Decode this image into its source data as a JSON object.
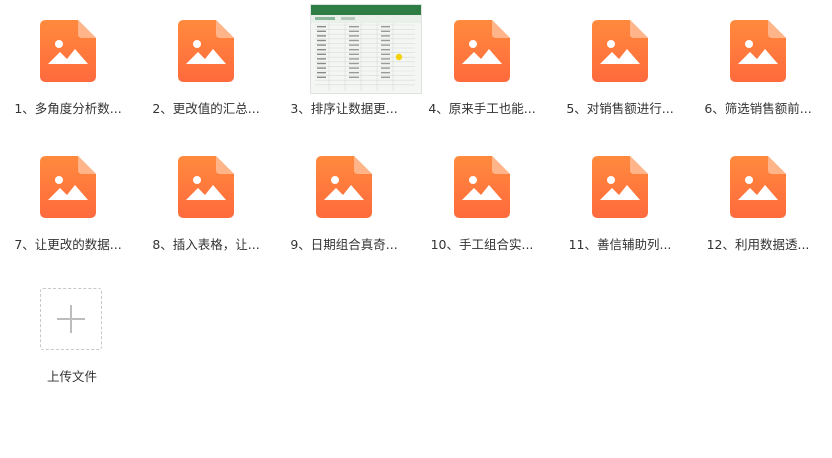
{
  "files": [
    {
      "label": "1、多角度分析数...",
      "type": "image-icon"
    },
    {
      "label": "2、更改值的汇总...",
      "type": "image-icon"
    },
    {
      "label": "3、排序让数据更...",
      "type": "spreadsheet-thumbnail"
    },
    {
      "label": "4、原来手工也能...",
      "type": "image-icon"
    },
    {
      "label": "5、对销售额进行...",
      "type": "image-icon"
    },
    {
      "label": "6、筛选销售额前...",
      "type": "image-icon"
    },
    {
      "label": "7、让更改的数据...",
      "type": "image-icon"
    },
    {
      "label": "8、插入表格，让...",
      "type": "image-icon"
    },
    {
      "label": "9、日期组合真奇...",
      "type": "image-icon"
    },
    {
      "label": "10、手工组合实...",
      "type": "image-icon"
    },
    {
      "label": "11、善信辅助列...",
      "type": "image-icon"
    },
    {
      "label": "12、利用数据透...",
      "type": "image-icon"
    }
  ],
  "upload": {
    "label": "上传文件",
    "icon": "plus-icon"
  },
  "colors": {
    "icon_gradient_top": "#FF8A3D",
    "icon_gradient_bottom": "#FF6A3D",
    "icon_fold": "#FFB48A"
  }
}
